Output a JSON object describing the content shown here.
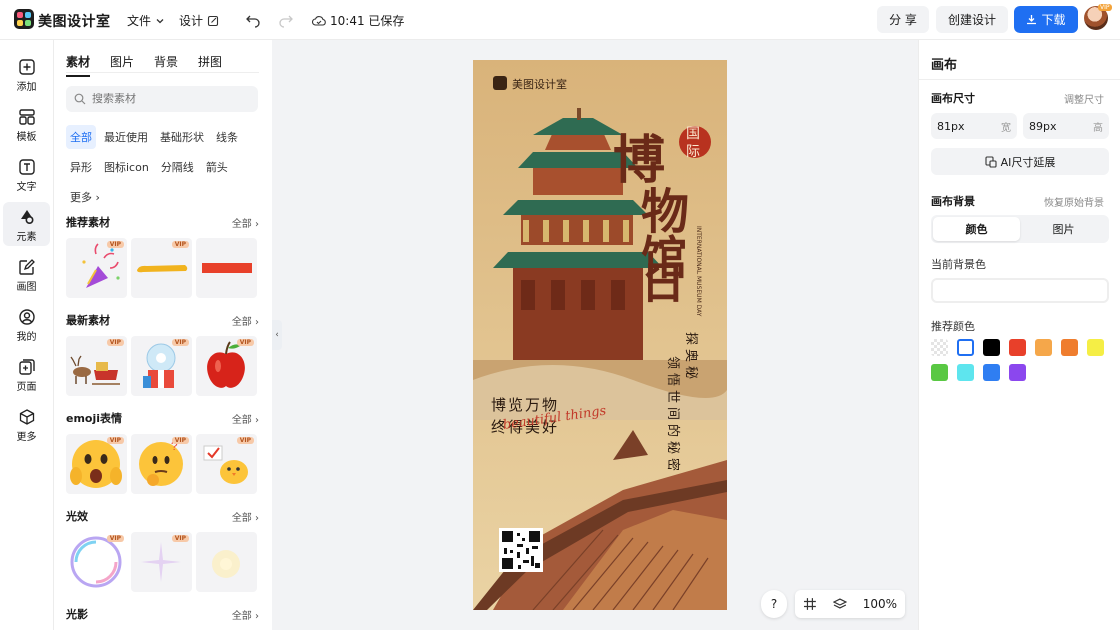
{
  "app": {
    "brand": "美图设计室"
  },
  "topbar": {
    "file_menu": "文件",
    "design_menu": "设计",
    "save_status": "10:41 已保存",
    "share_label": "分 享",
    "create_label": "创建设计",
    "download_label": "下载",
    "avatar_badge": "VIP"
  },
  "leftnav": {
    "items": [
      {
        "label": "添加",
        "icon": "plus-square-icon"
      },
      {
        "label": "模板",
        "icon": "template-icon"
      },
      {
        "label": "文字",
        "icon": "text-icon"
      },
      {
        "label": "元素",
        "icon": "shapes-icon"
      },
      {
        "label": "画图",
        "icon": "edit-icon"
      },
      {
        "label": "我的",
        "icon": "user-icon"
      },
      {
        "label": "页面",
        "icon": "page-add-icon"
      },
      {
        "label": "更多",
        "icon": "cube-icon"
      }
    ],
    "active_index": 3
  },
  "panel": {
    "tabs": [
      "素材",
      "图片",
      "背景",
      "拼图"
    ],
    "active_tab": 0,
    "search_placeholder": "搜索素材",
    "chips": [
      "全部",
      "最近使用",
      "基础形状",
      "线条",
      "异形",
      "图标icon",
      "分隔线",
      "箭头",
      "更多"
    ],
    "sections": [
      {
        "title": "推荐素材",
        "all": "全部",
        "vip": [
          "VIP",
          "VIP",
          ""
        ]
      },
      {
        "title": "最新素材",
        "all": "全部",
        "vip": [
          "VIP",
          "VIP",
          "VIP"
        ]
      },
      {
        "title": "emoji表情",
        "all": "全部",
        "vip": [
          "VIP",
          "VIP",
          "VIP"
        ]
      },
      {
        "title": "光效",
        "all": "全部",
        "vip": [
          "VIP",
          "VIP",
          ""
        ]
      },
      {
        "title": "光影",
        "all": "全部"
      }
    ]
  },
  "poster": {
    "logo_text": "美图设计室",
    "title_chars": [
      "博",
      "物",
      "馆",
      "日"
    ],
    "seal": [
      "国",
      "际"
    ],
    "english": "INTERNATIONAL MUSEUM DAY",
    "col1": "探奥秘",
    "col2": "领悟世间的秘密",
    "left_line1": "博览万物",
    "left_line2": "终得美好",
    "script": "beautiful things"
  },
  "canvas_controls": {
    "help": "?",
    "zoom": "100%"
  },
  "right": {
    "title": "画布",
    "size_label": "画布尺寸",
    "resize_link": "调整尺寸",
    "width_value": "81px",
    "width_unit": "宽",
    "height_value": "89px",
    "height_unit": "高",
    "ai_button": "AI尺寸延展",
    "bg_label": "画布背景",
    "restore_link": "恢复原始背景",
    "bg_tabs": [
      "颜色",
      "图片"
    ],
    "current_color_label": "当前背景色",
    "recommend_label": "推荐颜色",
    "swatches": [
      "transparent",
      "#ffffff",
      "#000000",
      "#e8402a",
      "#f5a74a",
      "#ef7d2e",
      "#f5ee45",
      "#59c843",
      "#5ee5ee",
      "#2f7ef2",
      "#8b47ee"
    ]
  }
}
